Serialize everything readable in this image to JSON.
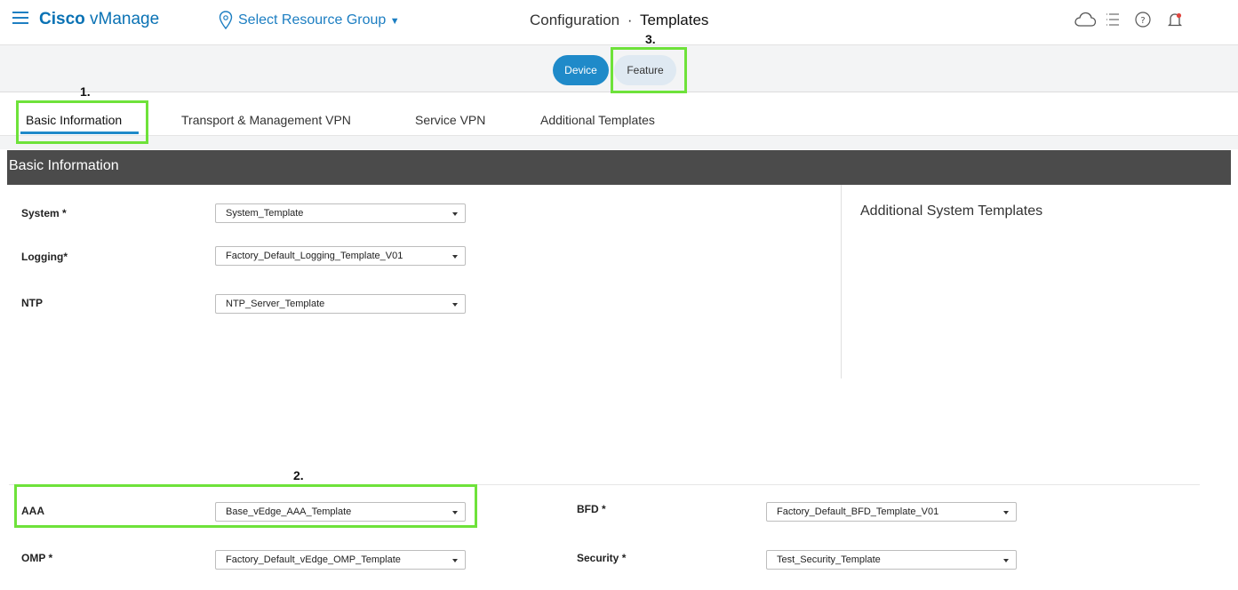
{
  "header": {
    "brand_bold": "Cisco",
    "brand_light": "vManage",
    "resource_group": "Select Resource Group",
    "title_section": "Configuration",
    "title_separator": "·",
    "title_current": "Templates"
  },
  "toggle": {
    "device": "Device",
    "feature": "Feature"
  },
  "tabs": [
    {
      "label": "Basic Information",
      "active": true
    },
    {
      "label": "Transport & Management VPN"
    },
    {
      "label": "Service VPN"
    },
    {
      "label": "Additional Templates"
    }
  ],
  "section": {
    "title": "Basic Information",
    "additional_title": "Additional System Templates"
  },
  "fields": {
    "system": {
      "label": "System *",
      "value": "System_Template"
    },
    "logging": {
      "label": "Logging*",
      "value": "Factory_Default_Logging_Template_V01"
    },
    "ntp": {
      "label": "NTP",
      "value": "NTP_Server_Template"
    },
    "aaa": {
      "label": "AAA",
      "value": "Base_vEdge_AAA_Template"
    },
    "bfd": {
      "label": "BFD *",
      "value": "Factory_Default_BFD_Template_V01"
    },
    "omp": {
      "label": "OMP *",
      "value": "Factory_Default_vEdge_OMP_Template"
    },
    "security": {
      "label": "Security *",
      "value": "Test_Security_Template"
    }
  },
  "annotations": {
    "step1": "1.",
    "step2": "2.",
    "step3": "3."
  },
  "colors": {
    "accent": "#1f8ac9",
    "brand": "#0a72b4",
    "highlight": "#6ee23a",
    "section_bg": "#4b4b4b"
  },
  "icons": {
    "menu": "hamburger-icon",
    "location": "location-pin-icon",
    "cloud": "cloud-icon",
    "tasks": "task-list-icon",
    "help": "help-icon",
    "alarms": "bell-icon"
  }
}
